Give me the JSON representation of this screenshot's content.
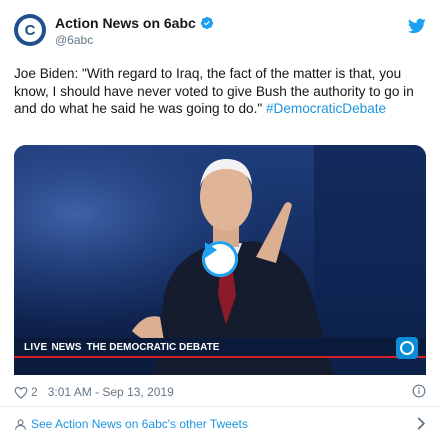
{
  "author": {
    "display_name": "Action News on 6abc",
    "handle": "@6abc",
    "avatar_letter": "C",
    "verified": true
  },
  "tweet": {
    "text": "Joe Biden: \"With regard to Iraq, the fact of the matter is that, you know, I should have never voted to give Bush the authority to go in and do what he said he was going to do.\" ",
    "hashtag": "#DemocraticDebate"
  },
  "media": {
    "chyron_live": "LIVE",
    "chyron_network": "NEWS",
    "chyron_title": "THE DEMOCRATIC DEBATE",
    "has_play_button": true
  },
  "meta": {
    "likes": "2",
    "timestamp": "3:01 AM - Sep 13, 2019"
  },
  "footer": {
    "link_text": "See Action News on 6abc's other Tweets"
  },
  "colors": {
    "link": "#1b95e0",
    "text": "#14171a",
    "muted": "#657786",
    "twitter_blue": "#1da1f2",
    "avatar": "#1f4f8f"
  },
  "icons": [
    "verified-badge-icon",
    "twitter-bird-icon",
    "play-icon",
    "heart-icon",
    "info-icon",
    "person-icon",
    "chevron-right-icon"
  ]
}
